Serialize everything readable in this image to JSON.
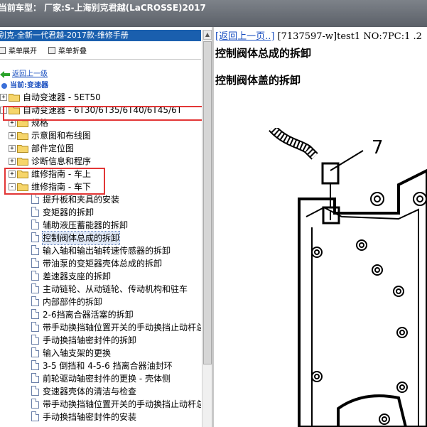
{
  "window": {
    "title": "当前车型： 厂家:S-上海别克君越(LaCROSSE)2017"
  },
  "left_pane": {
    "title": "别克-全新一代君越-2017款-维修手册",
    "toolbar": {
      "expand": "菜单展开",
      "collapse": "菜单折叠"
    },
    "back_link": "返回上一级",
    "current": "当前:变速器",
    "tree": [
      {
        "label": "自动变速器 - 5ET50",
        "level": 0,
        "type": "folder",
        "expander": "+"
      },
      {
        "label": "自动变速器 - 6T30/6T35/6T40/6T45/6T",
        "level": 0,
        "type": "folder",
        "expander": "-",
        "open": true,
        "highlight": true
      },
      {
        "label": "规格",
        "level": 1,
        "type": "folder",
        "expander": "+"
      },
      {
        "label": "示意图和布线图",
        "level": 1,
        "type": "folder",
        "expander": "+"
      },
      {
        "label": "部件定位图",
        "level": 1,
        "type": "folder",
        "expander": "+"
      },
      {
        "label": "诊断信息和程序",
        "level": 1,
        "type": "folder",
        "expander": "+"
      },
      {
        "label": "维修指南 - 车上",
        "level": 1,
        "type": "folder",
        "expander": "+",
        "highlight": true
      },
      {
        "label": "维修指南 - 车下",
        "level": 1,
        "type": "folder",
        "expander": "-",
        "open": true,
        "highlight": true
      },
      {
        "label": "提升板和夹具的安装",
        "level": 2,
        "type": "doc"
      },
      {
        "label": "变矩器的拆卸",
        "level": 2,
        "type": "doc"
      },
      {
        "label": "辅助液压蓄能器的拆卸",
        "level": 2,
        "type": "doc"
      },
      {
        "label": "控制阀体总成的拆卸",
        "level": 2,
        "type": "doc",
        "selected": true
      },
      {
        "label": "输入轴和输出轴转速传感器的拆卸",
        "level": 2,
        "type": "doc"
      },
      {
        "label": "带油泵的变矩器壳体总成的拆卸",
        "level": 2,
        "type": "doc"
      },
      {
        "label": "差速器支座的拆卸",
        "level": 2,
        "type": "doc"
      },
      {
        "label": "主动链轮、从动链轮、传动机构和驻车",
        "level": 2,
        "type": "doc"
      },
      {
        "label": "内部部件的拆卸",
        "level": 2,
        "type": "doc"
      },
      {
        "label": "2-6挡离合器活塞的拆卸",
        "level": 2,
        "type": "doc"
      },
      {
        "label": "带手动换挡轴位置开关的手动换挡止动杆总",
        "level": 2,
        "type": "doc"
      },
      {
        "label": "手动换挡轴密封件的拆卸",
        "level": 2,
        "type": "doc"
      },
      {
        "label": "输入轴支架的更换",
        "level": 2,
        "type": "doc"
      },
      {
        "label": "3-5 倒挡和 4-5-6 挡离合器油封环",
        "level": 2,
        "type": "doc"
      },
      {
        "label": "前轮驱动轴密封件的更换 - 壳体侧",
        "level": 2,
        "type": "doc"
      },
      {
        "label": "变速器壳体的清洁与检查",
        "level": 2,
        "type": "doc"
      },
      {
        "label": "带手动换挡轴位置开关的手动换挡止动杆总",
        "level": 2,
        "type": "doc"
      },
      {
        "label": "手动换挡轴密封件的安装",
        "level": 2,
        "type": "doc"
      }
    ]
  },
  "right_pane": {
    "back_link": "[返回上一页..]",
    "doc_info": "[7137597-w]test1 NO:7PC:1 .2",
    "title": "控制阀体总成的拆卸",
    "subtitle": "控制阀体盖的拆卸",
    "callout": "7"
  },
  "colors": {
    "highlight_box": "#e23636",
    "title_bar": "#1a5fae",
    "link": "#1a4fc0"
  }
}
